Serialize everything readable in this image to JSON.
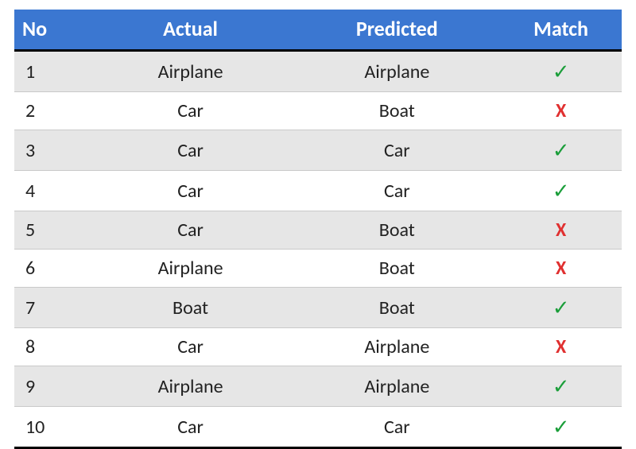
{
  "headers": {
    "no": "No",
    "actual": "Actual",
    "predicted": "Predicted",
    "match": "Match"
  },
  "rows": [
    {
      "no": "1",
      "actual": "Airplane",
      "predicted": "Airplane",
      "match": true
    },
    {
      "no": "2",
      "actual": "Car",
      "predicted": "Boat",
      "match": false
    },
    {
      "no": "3",
      "actual": "Car",
      "predicted": "Car",
      "match": true
    },
    {
      "no": "4",
      "actual": "Car",
      "predicted": "Car",
      "match": true
    },
    {
      "no": "5",
      "actual": "Car",
      "predicted": "Boat",
      "match": false
    },
    {
      "no": "6",
      "actual": "Airplane",
      "predicted": "Boat",
      "match": false
    },
    {
      "no": "7",
      "actual": "Boat",
      "predicted": "Boat",
      "match": true
    },
    {
      "no": "8",
      "actual": "Car",
      "predicted": "Airplane",
      "match": false
    },
    {
      "no": "9",
      "actual": "Airplane",
      "predicted": "Airplane",
      "match": true
    },
    {
      "no": "10",
      "actual": "Car",
      "predicted": "Car",
      "match": true
    }
  ],
  "icons": {
    "yes": "✓",
    "no": "X"
  },
  "chart_data": {
    "type": "table",
    "title": "",
    "columns": [
      "No",
      "Actual",
      "Predicted",
      "Match"
    ],
    "rows": [
      [
        1,
        "Airplane",
        "Airplane",
        true
      ],
      [
        2,
        "Car",
        "Boat",
        false
      ],
      [
        3,
        "Car",
        "Car",
        true
      ],
      [
        4,
        "Car",
        "Car",
        true
      ],
      [
        5,
        "Car",
        "Boat",
        false
      ],
      [
        6,
        "Airplane",
        "Boat",
        false
      ],
      [
        7,
        "Boat",
        "Boat",
        true
      ],
      [
        8,
        "Car",
        "Airplane",
        false
      ],
      [
        9,
        "Airplane",
        "Airplane",
        true
      ],
      [
        10,
        "Car",
        "Car",
        true
      ]
    ]
  }
}
